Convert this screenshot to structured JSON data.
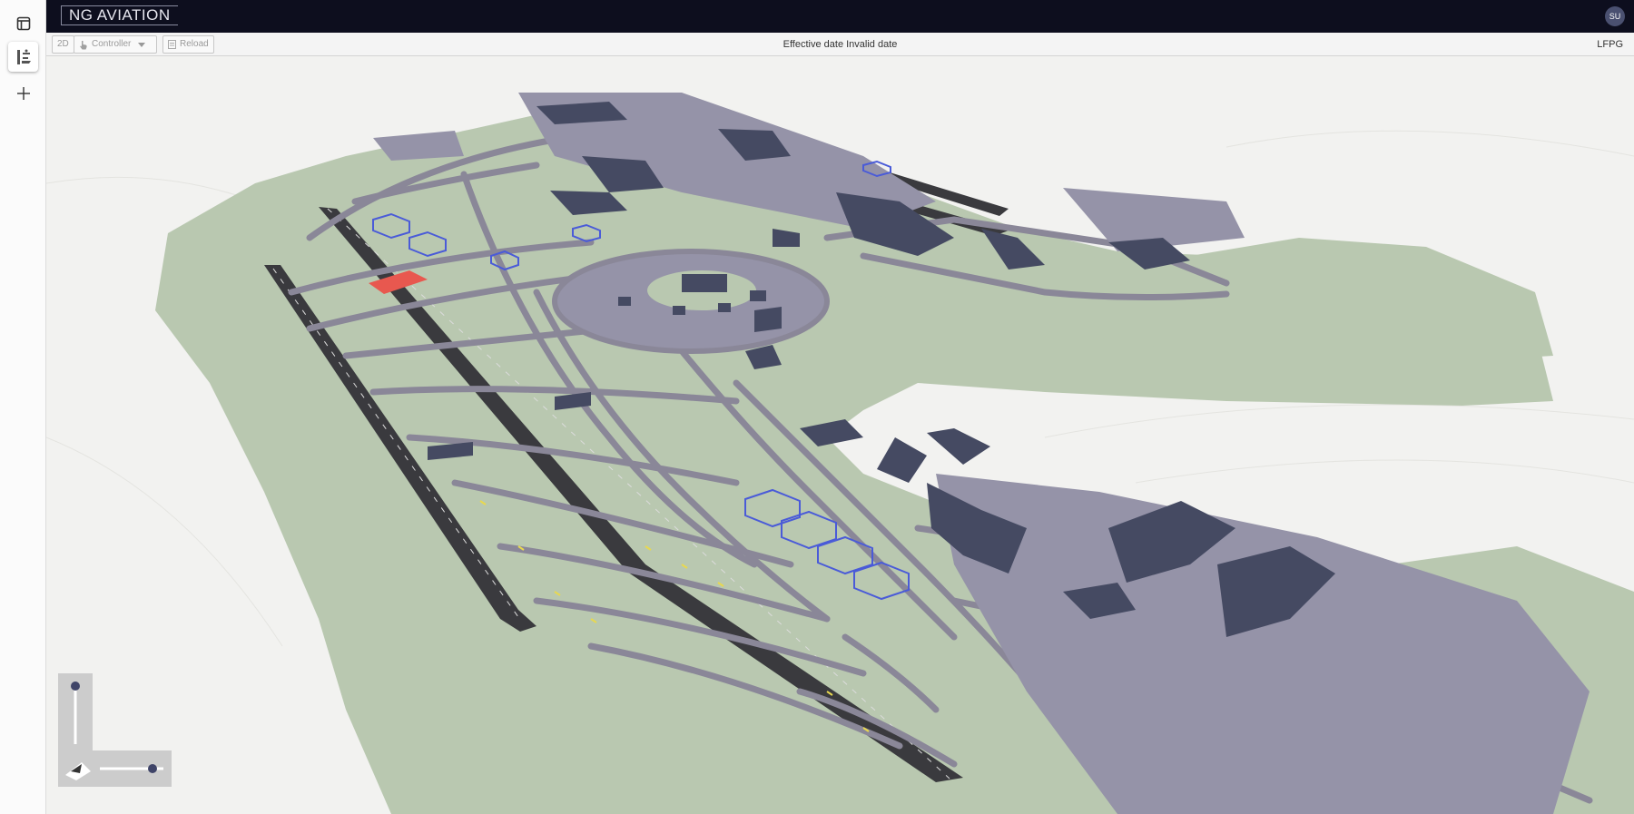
{
  "app": {
    "brand": "NG AVIATION",
    "user_initials": "SU"
  },
  "sidebar": {
    "items": [
      {
        "icon": "layout-panel-icon"
      },
      {
        "icon": "airport-map-icon",
        "active": true
      },
      {
        "icon": "plus-icon"
      }
    ]
  },
  "toolbar": {
    "view_mode_label": "2D",
    "role_label": "Controller",
    "reload_label": "Reload",
    "effective_date_label": "Effective date Invalid date",
    "airport_code": "LFPG"
  },
  "colors": {
    "topbar": "#0d0e1e",
    "grass": "#b9c8b0",
    "taxiway": "#8a8798",
    "runway": "#3a3a3e",
    "apron": "#9593a8",
    "building": "#454a62",
    "highlight_red": "#e8584f",
    "stand_blue": "#4a5bd8"
  }
}
